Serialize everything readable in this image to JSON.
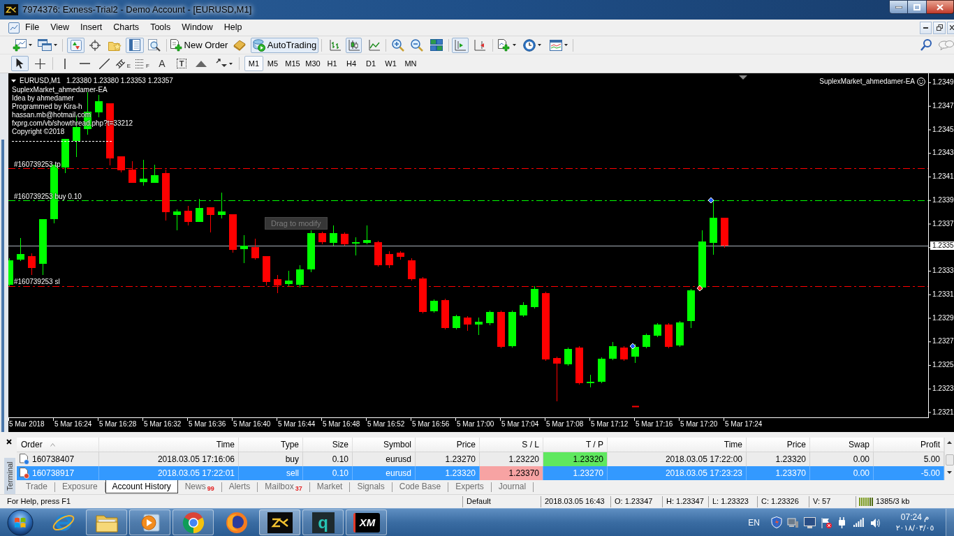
{
  "window": {
    "title": "7974376: Exness-Trial2 - Demo Account - [EURUSD,M1]"
  },
  "menu": [
    "File",
    "View",
    "Insert",
    "Charts",
    "Tools",
    "Window",
    "Help"
  ],
  "toolbar": {
    "buttons": [
      {
        "pressed": false
      },
      {
        "pressed": false
      },
      {
        "pressed": true
      },
      {
        "pressed": false
      },
      {
        "pressed": false
      },
      {
        "pressed": true
      },
      {
        "pressed": false
      },
      {
        "pressed": false
      }
    ],
    "new_order": "New Order",
    "autotrading": {
      "label": "AutoTrading",
      "pressed": true
    },
    "chart_buttons": [
      {
        "pressed": false
      },
      {
        "pressed": true
      },
      {
        "pressed": false
      },
      {
        "pressed": false
      },
      {
        "pressed": false
      },
      {
        "pressed": false
      },
      {
        "pressed": true
      },
      {
        "pressed": false
      },
      {
        "pressed": false
      },
      {
        "pressed": false
      },
      {
        "pressed": false
      }
    ]
  },
  "drawing_toolbar": {
    "tools": [
      {
        "pressed": true
      },
      {
        "pressed": false
      },
      {
        "pressed": false
      },
      {
        "pressed": false
      },
      {
        "pressed": false
      },
      {
        "pressed": false,
        "subscript": "E"
      },
      {
        "pressed": false,
        "subscript": "F"
      },
      {
        "pressed": false,
        "glyph": "A"
      },
      {
        "pressed": false,
        "glyph": "T"
      },
      {
        "pressed": false
      },
      {
        "pressed": false
      }
    ],
    "timeframes": [
      {
        "label": "M1",
        "selected": true
      },
      {
        "label": "M5",
        "selected": false
      },
      {
        "label": "M15",
        "selected": false
      },
      {
        "label": "M30",
        "selected": false
      },
      {
        "label": "H1",
        "selected": false
      },
      {
        "label": "H4",
        "selected": false
      },
      {
        "label": "D1",
        "selected": false
      },
      {
        "label": "W1",
        "selected": false
      },
      {
        "label": "MN",
        "selected": false
      }
    ]
  },
  "chart": {
    "symbol": "EURUSD,M1",
    "quote": "1.23380 1.23380 1.23353 1.23357",
    "comment": [
      "SuplexMarket_ahmedamer-EA",
      "Idea by ahmedamer",
      "Programmed by Kira-h",
      "hassan.mb@hotmail.com",
      "fxprg.com/vb/showthread.php?t=33212",
      "Copyright ©2018"
    ],
    "expert": "SuplexMarket_ahmedamer-EA",
    "order_lines": [
      {
        "kind": "tp",
        "label": "#160739253 tp"
      },
      {
        "kind": "entry",
        "label": "#160739253 buy 0.10"
      },
      {
        "kind": "sl",
        "label": "#160739253 sl"
      }
    ],
    "tooltip": "Drag to modify",
    "price_labels": [
      "1.2349",
      "1.2347",
      "1.2345",
      "1.2343",
      "1.2341",
      "1.2339",
      "1.2337",
      "1.2333",
      "1.2331",
      "1.2329",
      "1.2327",
      "1.2325",
      "1.2323",
      "1.2321"
    ],
    "current_price": "1.2335",
    "time_labels": [
      "5 Mar 2018",
      "5 Mar 16:24",
      "5 Mar 16:28",
      "5 Mar 16:32",
      "5 Mar 16:36",
      "5 Mar 16:40",
      "5 Mar 16:44",
      "5 Mar 16:48",
      "5 Mar 16:52",
      "5 Mar 16:56",
      "5 Mar 17:00",
      "5 Mar 17:04",
      "5 Mar 17:08",
      "5 Mar 17:12",
      "5 Mar 17:16",
      "5 Mar 17:20",
      "5 Mar 17:24"
    ]
  },
  "terminal": {
    "title": "Terminal",
    "columns": [
      "Order",
      "Time",
      "Type",
      "Size",
      "Symbol",
      "Price",
      "S / L",
      "T / P",
      "Time",
      "Price",
      "Swap",
      "Profit"
    ],
    "rows": [
      {
        "kind": "buy",
        "selected": false,
        "sl_hit": false,
        "tp_hit": true,
        "cells": [
          "160738407",
          "2018.03.05 17:16:06",
          "buy",
          "0.10",
          "eurusd",
          "1.23270",
          "1.23220",
          "1.23320",
          "2018.03.05 17:22:00",
          "1.23320",
          "0.00",
          "5.00"
        ]
      },
      {
        "kind": "sell",
        "selected": true,
        "sl_hit": true,
        "tp_hit": false,
        "cells": [
          "160738917",
          "2018.03.05 17:22:01",
          "sell",
          "0.10",
          "eurusd",
          "1.23320",
          "1.23370",
          "1.23270",
          "2018.03.05 17:23:23",
          "1.23370",
          "0.00",
          "-5.00"
        ]
      }
    ],
    "tabs": [
      {
        "label": "Trade",
        "selected": false
      },
      {
        "label": "Exposure",
        "selected": false
      },
      {
        "label": "Account History",
        "selected": true
      },
      {
        "label": "News",
        "count": "99",
        "selected": false
      },
      {
        "label": "Alerts",
        "selected": false
      },
      {
        "label": "Mailbox",
        "count": "37",
        "selected": false
      },
      {
        "label": "Market",
        "selected": false
      },
      {
        "label": "Signals",
        "selected": false
      },
      {
        "label": "Code Base",
        "selected": false
      },
      {
        "label": "Experts",
        "selected": false
      },
      {
        "label": "Journal",
        "selected": false
      }
    ]
  },
  "status_bar": {
    "help": "For Help, press F1",
    "fields": [
      "Default",
      "2018.03.05 16:43",
      "O: 1.23347",
      "H: 1.23347",
      "L: 1.23323",
      "C: 1.23326",
      "V: 57"
    ],
    "traffic": "1385/3 kb"
  },
  "taskbar": {
    "apps": [
      {
        "running": false,
        "active": false
      },
      {
        "running": true,
        "active": false
      },
      {
        "running": true,
        "active": false
      },
      {
        "running": true,
        "active": false
      },
      {
        "running": false,
        "active": false
      },
      {
        "running": true,
        "active": true
      },
      {
        "running": true,
        "active": false,
        "logo_text": "q"
      },
      {
        "running": true,
        "active": false,
        "logo_text": "XM"
      }
    ],
    "language": "EN",
    "time": "07:24 م",
    "date": "٢٠١٨/٠٣/٠٥"
  }
}
